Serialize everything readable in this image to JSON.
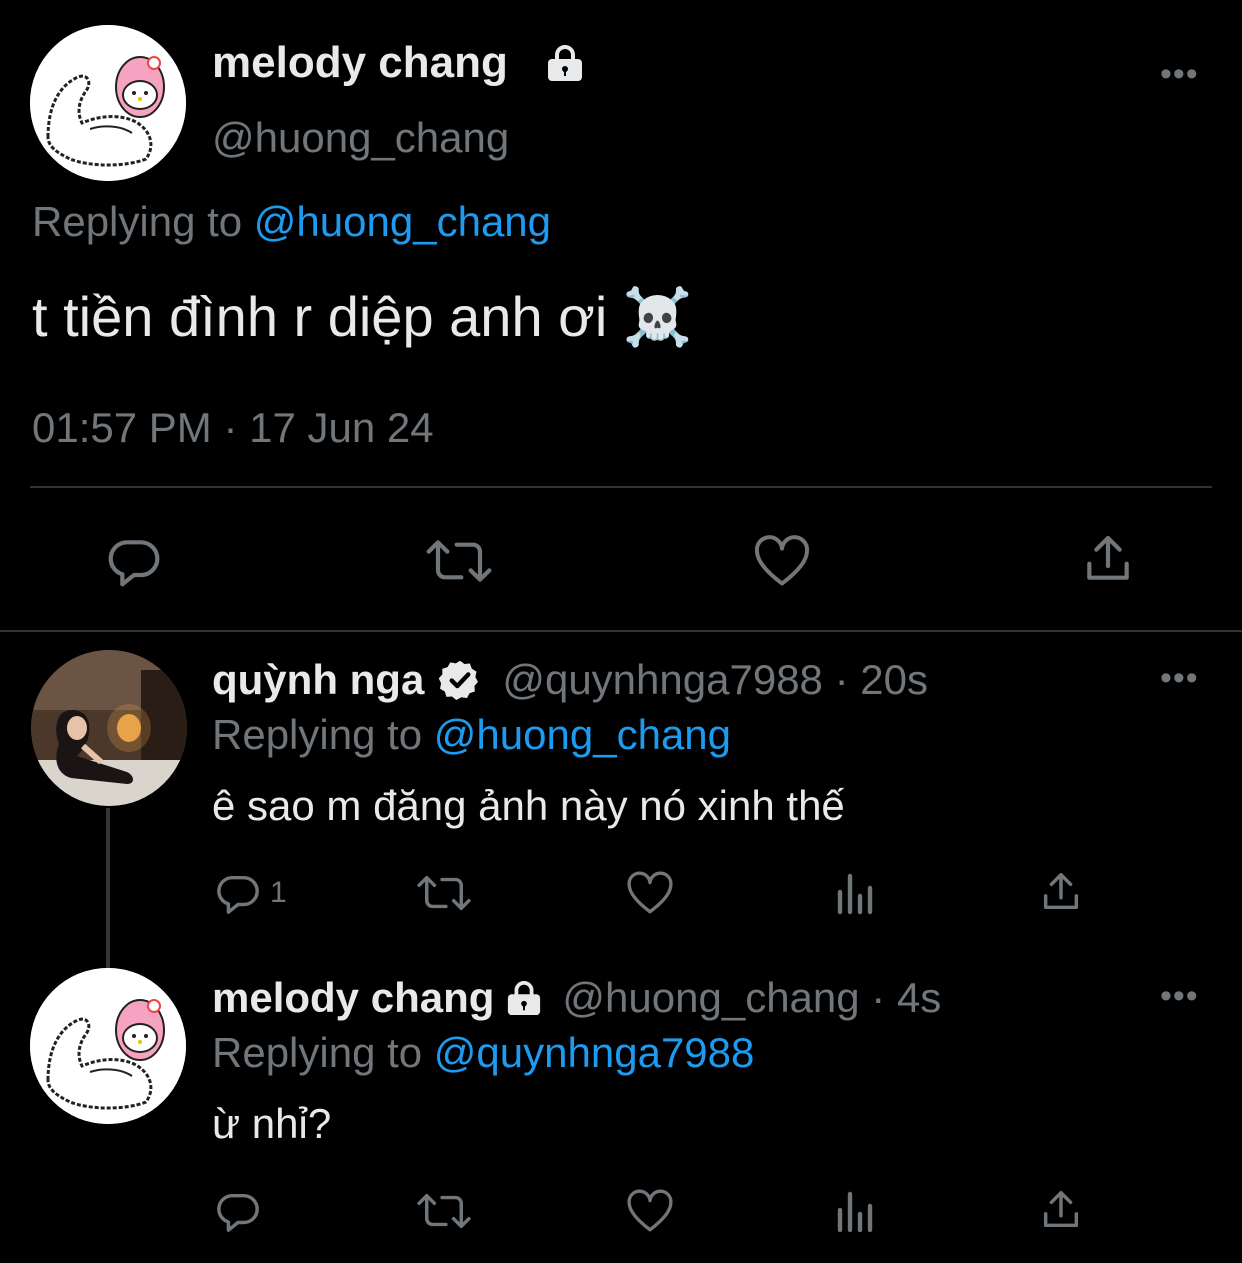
{
  "main_tweet": {
    "author_name": "melody chang",
    "handle": "@huong_chang",
    "replying_prefix": "Replying to ",
    "replying_to": "@huong_chang",
    "text": "t tiền đình r diệp anh ơi ☠️",
    "timestamp": "01:57 PM · 17 Jun 24",
    "more_label": "•••"
  },
  "reply1": {
    "author_name": "quỳnh nga",
    "handle_time": "@quynhnga7988 · 20s",
    "replying_prefix": "Replying to ",
    "replying_to": "@huong_chang",
    "text": "ê sao m đăng ảnh này nó xinh thế",
    "reply_count": "1",
    "more_label": "•••"
  },
  "reply2": {
    "author_name": "melody chang",
    "handle_time": "@huong_chang · 4s",
    "replying_prefix": "Replying to ",
    "replying_to": "@quynhnga7988",
    "text": "ừ nhỉ?",
    "more_label": "•••"
  },
  "colors": {
    "background": "#000000",
    "text": "#e7e9ea",
    "muted": "#71767b",
    "link": "#1d9bf0",
    "divider": "#2f3336"
  },
  "icons": [
    "lock-icon",
    "verified-icon",
    "reply-icon",
    "retweet-icon",
    "like-icon",
    "share-icon",
    "views-icon",
    "more-icon"
  ]
}
